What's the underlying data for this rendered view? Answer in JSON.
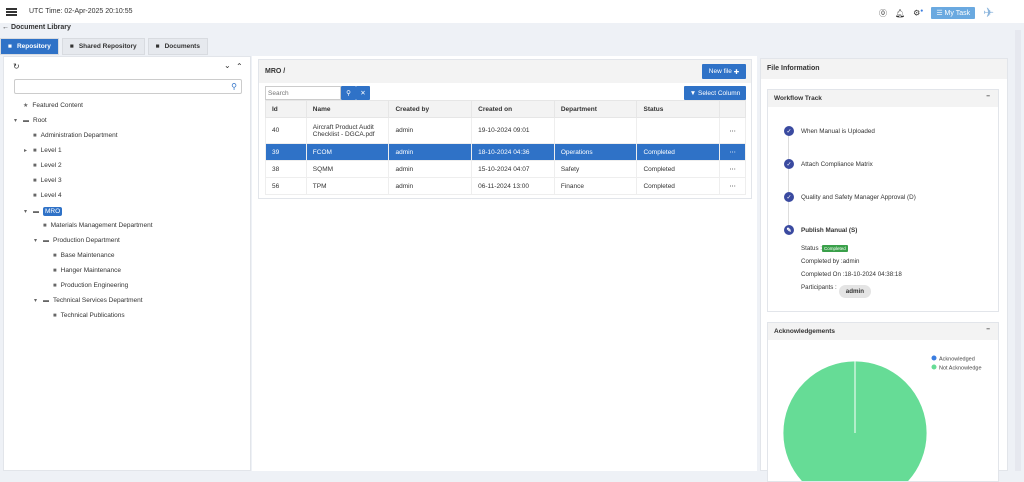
{
  "header": {
    "utc": "UTC Time: 02-Apr-2025 20:10:55",
    "my_task": "My Task"
  },
  "breadcrumb": "Document Library",
  "tabs": [
    "Repository",
    "Shared Repository",
    "Documents"
  ],
  "tree": [
    {
      "label": "Featured Content",
      "lvl": 0,
      "icon": "star"
    },
    {
      "label": "Root",
      "lvl": 0,
      "icon": "folder-open",
      "caret": "▾"
    },
    {
      "label": "Administration Department",
      "lvl": 1,
      "icon": "folder"
    },
    {
      "label": "Level 1",
      "lvl": 1,
      "icon": "folder",
      "caret": "▸"
    },
    {
      "label": "Level 2",
      "lvl": 1,
      "icon": "folder"
    },
    {
      "label": "Level 3",
      "lvl": 1,
      "icon": "folder"
    },
    {
      "label": "Level 4",
      "lvl": 1,
      "icon": "folder"
    },
    {
      "label": "MRO",
      "lvl": 1,
      "icon": "folder-open",
      "caret": "▾",
      "selected": true
    },
    {
      "label": "Materials Management Department",
      "lvl": 2,
      "icon": "folder"
    },
    {
      "label": "Production Department",
      "lvl": 2,
      "icon": "folder-open",
      "caret": "▾"
    },
    {
      "label": "Base Maintenance",
      "lvl": 3,
      "icon": "folder"
    },
    {
      "label": "Hanger Maintenance",
      "lvl": 3,
      "icon": "folder"
    },
    {
      "label": "Production Engineering",
      "lvl": 3,
      "icon": "folder"
    },
    {
      "label": "Technical Services Department",
      "lvl": 2,
      "icon": "folder-open",
      "caret": "▾"
    },
    {
      "label": "Technical Publications",
      "lvl": 3,
      "icon": "folder"
    }
  ],
  "main": {
    "path": "MRO /",
    "new_file": "New file",
    "search_placeholder": "Search",
    "select_column": "Select Column",
    "columns": [
      "Id",
      "Name",
      "Created by",
      "Created on",
      "Department",
      "Status"
    ],
    "rows": [
      {
        "id": "40",
        "name": "Aircraft Product Audit Checklist - DGCA.pdf",
        "by": "admin",
        "on": "19-10-2024 09:01",
        "dept": "",
        "status": ""
      },
      {
        "id": "39",
        "name": "FCOM",
        "by": "admin",
        "on": "18-10-2024 04:36",
        "dept": "Operations",
        "status": "Completed",
        "selected": true
      },
      {
        "id": "38",
        "name": "SQMM",
        "by": "admin",
        "on": "15-10-2024 04:07",
        "dept": "Safety",
        "status": "Completed"
      },
      {
        "id": "56",
        "name": "TPM",
        "by": "admin",
        "on": "06-11-2024 13:00",
        "dept": "Finance",
        "status": "Completed"
      }
    ]
  },
  "right": {
    "title": "File Information",
    "workflow": {
      "title": "Workflow Track",
      "steps": [
        "When Manual is Uploaded",
        "Attach Compliance Matrix",
        "Quality and Safety Manager Approval (D)",
        "Publish Manual (S)"
      ],
      "status_label": "Status :",
      "status": "Completed",
      "completed_by": "Completed by :admin",
      "completed_on": "Completed On :18-10-2024 04:38:18",
      "participants_label": "Participants :",
      "participant": "admin"
    },
    "ack": {
      "title": "Acknowledgements",
      "legend": [
        "Acknowledged",
        "Not Acknowledge"
      ]
    }
  },
  "chart_data": {
    "type": "pie",
    "title": "Acknowledgements",
    "categories": [
      "Acknowledged",
      "Not Acknowledge"
    ],
    "values": [
      0,
      100
    ],
    "colors": [
      "#3b7de0",
      "#66dc96"
    ],
    "legend": "top-right"
  }
}
